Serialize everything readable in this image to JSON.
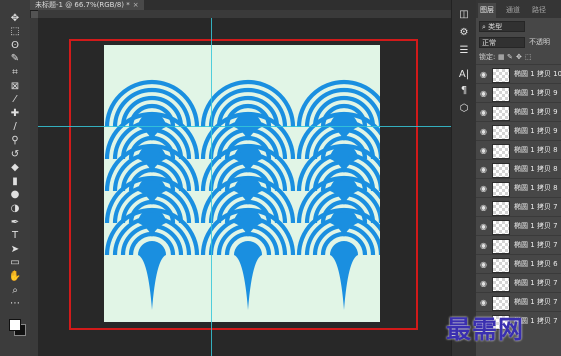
{
  "document": {
    "tab_title": "未标题-1 @ 66.7%(RGB/8) *",
    "close_glyph": "×"
  },
  "tools": [
    {
      "name": "move-tool",
      "glyph": "✥"
    },
    {
      "name": "marquee-tool",
      "glyph": "⬚"
    },
    {
      "name": "lasso-tool",
      "glyph": "ʘ"
    },
    {
      "name": "quick-select-tool",
      "glyph": "✎"
    },
    {
      "name": "crop-tool",
      "glyph": "⌗"
    },
    {
      "name": "frame-tool",
      "glyph": "⊠"
    },
    {
      "name": "eyedropper-tool",
      "glyph": "⁄"
    },
    {
      "name": "healing-brush-tool",
      "glyph": "✚"
    },
    {
      "name": "brush-tool",
      "glyph": "/"
    },
    {
      "name": "stamp-tool",
      "glyph": "⚲"
    },
    {
      "name": "history-brush-tool",
      "glyph": "↺"
    },
    {
      "name": "eraser-tool",
      "glyph": "◆"
    },
    {
      "name": "gradient-tool",
      "glyph": "▮"
    },
    {
      "name": "blur-tool",
      "glyph": "●"
    },
    {
      "name": "dodge-tool",
      "glyph": "◑"
    },
    {
      "name": "pen-tool",
      "glyph": "✒"
    },
    {
      "name": "type-tool",
      "glyph": "T"
    },
    {
      "name": "path-select-tool",
      "glyph": "➤"
    },
    {
      "name": "shape-tool",
      "glyph": "▭"
    },
    {
      "name": "hand-tool",
      "glyph": "✋"
    },
    {
      "name": "zoom-tool",
      "glyph": "⌕"
    },
    {
      "name": "more-tools",
      "glyph": "⋯"
    }
  ],
  "strip_icons": [
    {
      "name": "history-icon",
      "glyph": "◫"
    },
    {
      "name": "adjust-icon",
      "glyph": "⚙"
    },
    {
      "name": "properties-icon",
      "glyph": "☰"
    },
    {
      "name": "character-icon",
      "glyph": "A|"
    },
    {
      "name": "paragraph-icon",
      "glyph": "¶"
    },
    {
      "name": "3d-icon",
      "glyph": "⬡"
    }
  ],
  "layers_panel": {
    "tabs": [
      "图层",
      "通道",
      "路径"
    ],
    "filter_icon": "⌕",
    "filter_label": "类型",
    "blend_mode": "正常",
    "opacity_label": "不透明",
    "lock_label": "锁定:",
    "lock_icons": [
      "▦",
      "✎",
      "✥",
      "⬚"
    ],
    "eye_glyph": "◉",
    "layers": [
      {
        "name": "椭圆 1 拷贝 10"
      },
      {
        "name": "椭圆 1 拷贝 9"
      },
      {
        "name": "椭圆 1 拷贝 9"
      },
      {
        "name": "椭圆 1 拷贝 9"
      },
      {
        "name": "椭圆 1 拷贝 8"
      },
      {
        "name": "椭圆 1 拷贝 8"
      },
      {
        "name": "椭圆 1 拷贝 8"
      },
      {
        "name": "椭圆 1 拷贝 7"
      },
      {
        "name": "椭圆 1 拷贝 7"
      },
      {
        "name": "椭圆 1 拷贝 7"
      },
      {
        "name": "椭圆 1 拷贝 6"
      },
      {
        "name": "椭圆 1 拷贝 7"
      },
      {
        "name": "椭圆 1 拷贝 7"
      },
      {
        "name": "椭圆 1 拷贝 7"
      }
    ]
  },
  "canvas": {
    "background_color": "#e1f5e6",
    "pattern_color": "#1a8fe0",
    "selection_color": "#d11a1a",
    "guide_color": "#36c7d8"
  },
  "watermark": "最需网"
}
